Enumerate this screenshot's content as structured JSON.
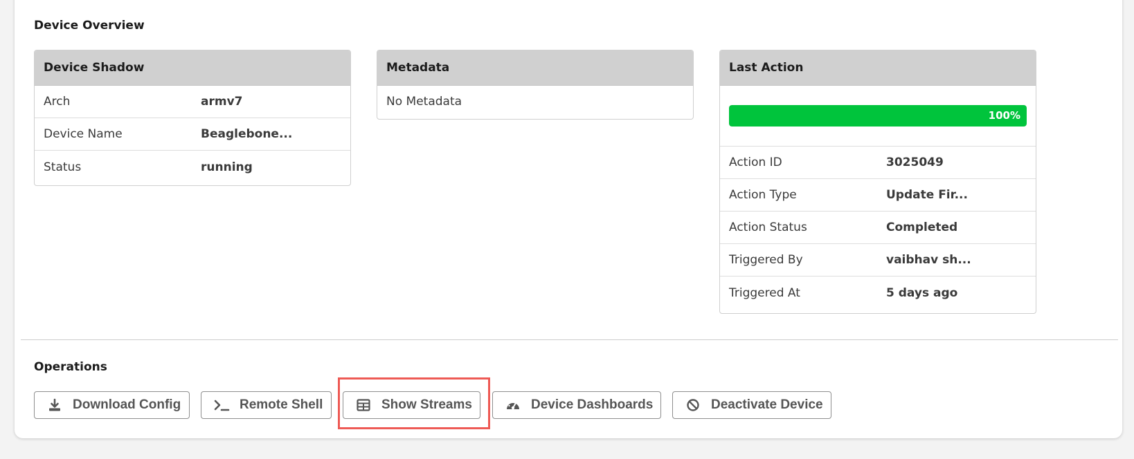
{
  "overview": {
    "title": "Device Overview"
  },
  "device_shadow": {
    "title": "Device Shadow",
    "rows": [
      {
        "key": "Arch",
        "value": "armv7"
      },
      {
        "key": "Device Name",
        "value": "Beaglebone..."
      },
      {
        "key": "Status",
        "value": "running"
      }
    ]
  },
  "metadata": {
    "title": "Metadata",
    "empty_text": "No Metadata"
  },
  "last_action": {
    "title": "Last Action",
    "progress": {
      "percent": 100,
      "label": "100%"
    },
    "rows": [
      {
        "key": "Action ID",
        "value": "3025049"
      },
      {
        "key": "Action Type",
        "value": "Update Fir..."
      },
      {
        "key": "Action Status",
        "value": "Completed"
      },
      {
        "key": "Triggered By",
        "value": "vaibhav sh..."
      },
      {
        "key": "Triggered At",
        "value": "5 days ago"
      }
    ]
  },
  "operations": {
    "title": "Operations",
    "buttons": [
      {
        "label": "Download Config",
        "icon": "download-icon"
      },
      {
        "label": "Remote Shell",
        "icon": "terminal-icon"
      },
      {
        "label": "Show Streams",
        "icon": "table-icon"
      },
      {
        "label": "Device Dashboards",
        "icon": "gauge-icon"
      },
      {
        "label": "Deactivate Device",
        "icon": "ban-icon"
      }
    ]
  },
  "colors": {
    "progress_fill": "#00c43c",
    "highlight": "#ee5a55",
    "card_header": "#d0d0d0"
  }
}
